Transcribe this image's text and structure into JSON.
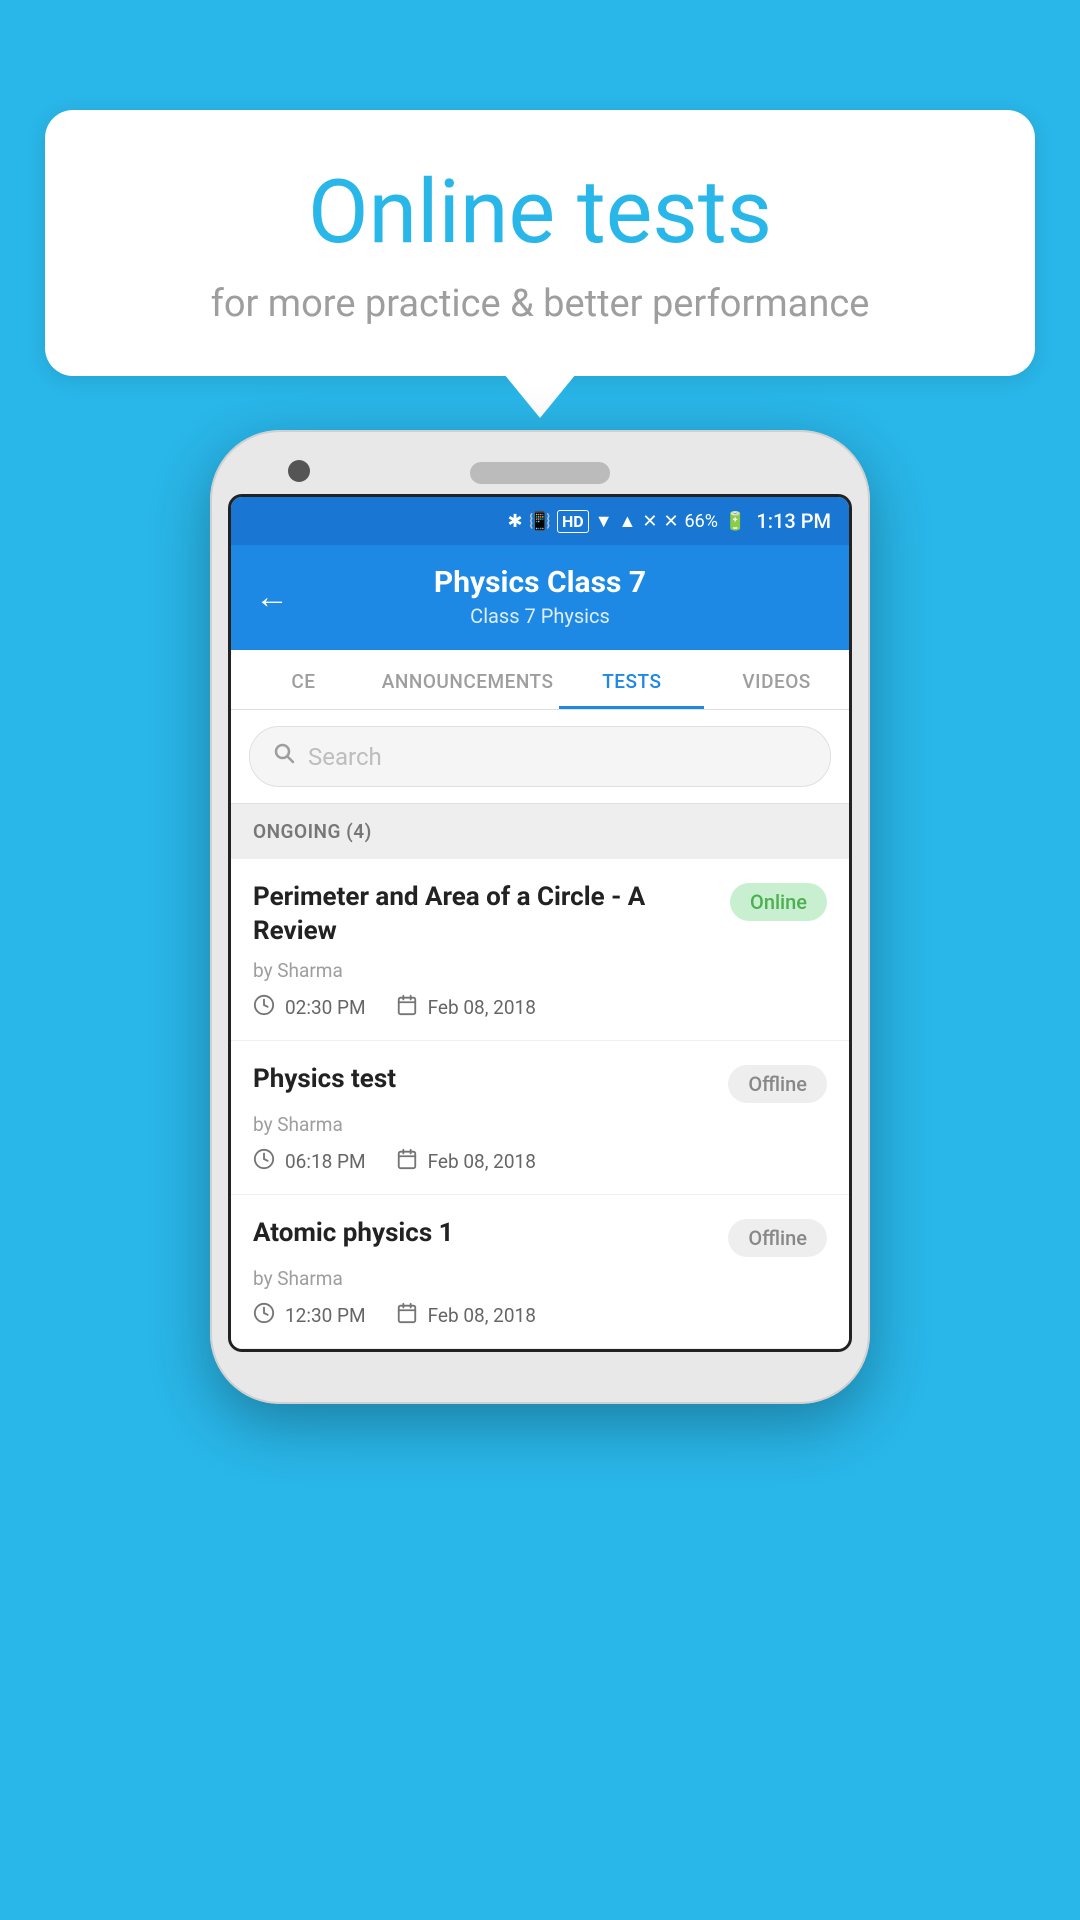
{
  "background_color": "#29b6e8",
  "bubble": {
    "title": "Online tests",
    "subtitle": "for more practice & better performance"
  },
  "status_bar": {
    "time": "1:13 PM",
    "battery": "66%",
    "icons": "🔷 📳 HD ▼ ✕ ✕"
  },
  "header": {
    "back_label": "←",
    "title": "Physics Class 7",
    "breadcrumb": "Class 7   Physics"
  },
  "tabs": [
    {
      "label": "CE",
      "active": false
    },
    {
      "label": "ANNOUNCEMENTS",
      "active": false
    },
    {
      "label": "TESTS",
      "active": true
    },
    {
      "label": "VIDEOS",
      "active": false
    }
  ],
  "search": {
    "placeholder": "Search"
  },
  "section": {
    "label": "ONGOING (4)"
  },
  "tests": [
    {
      "title": "Perimeter and Area of a Circle - A Review",
      "author": "by Sharma",
      "time": "02:30 PM",
      "date": "Feb 08, 2018",
      "badge": "Online",
      "badge_type": "online"
    },
    {
      "title": "Physics test",
      "author": "by Sharma",
      "time": "06:18 PM",
      "date": "Feb 08, 2018",
      "badge": "Offline",
      "badge_type": "offline"
    },
    {
      "title": "Atomic physics 1",
      "author": "by Sharma",
      "time": "12:30 PM",
      "date": "Feb 08, 2018",
      "badge": "Offline",
      "badge_type": "offline"
    }
  ]
}
